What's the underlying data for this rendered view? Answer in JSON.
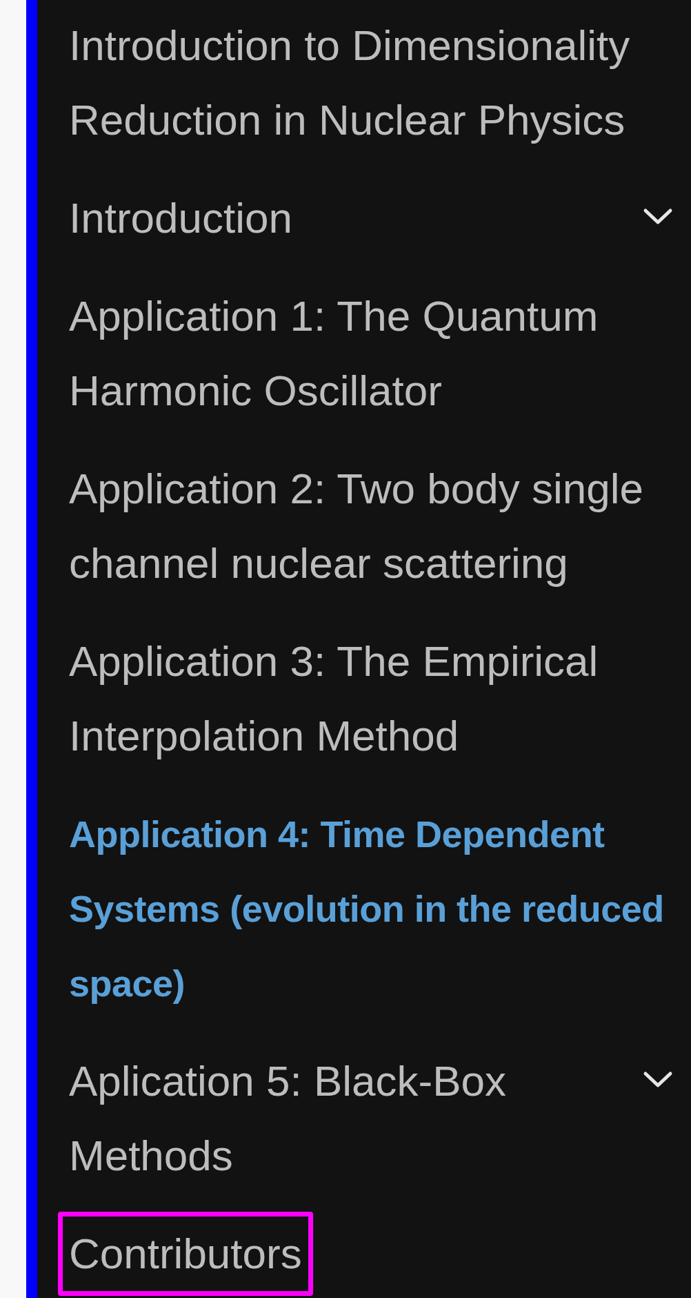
{
  "nav": {
    "items": [
      {
        "label": "Introduction to Dimensionality Reduction in Nuclear Physics",
        "selected": false,
        "has_subsections": false,
        "focused": false
      },
      {
        "label": "Introduction",
        "selected": false,
        "has_subsections": true,
        "focused": false
      },
      {
        "label": "Application 1: The Quantum Harmonic Oscillator",
        "selected": false,
        "has_subsections": false,
        "focused": false
      },
      {
        "label": "Application 2: Two body single channel nuclear scattering",
        "selected": false,
        "has_subsections": false,
        "focused": false
      },
      {
        "label": "Application 3: The Empirical Interpolation Method",
        "selected": false,
        "has_subsections": false,
        "focused": false
      },
      {
        "label": "Application 4: Time Dependent Systems (evolution in the reduced space)",
        "selected": true,
        "has_subsections": false,
        "focused": false
      },
      {
        "label": "Aplication 5: Black-Box Methods",
        "selected": false,
        "has_subsections": true,
        "focused": false
      },
      {
        "label": "Contributors",
        "selected": false,
        "has_subsections": false,
        "focused": true
      }
    ]
  }
}
